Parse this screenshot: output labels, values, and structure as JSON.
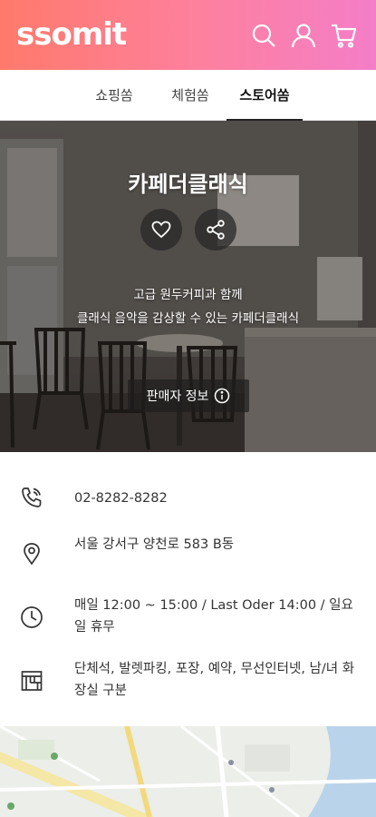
{
  "header": {
    "logo": "ssomit",
    "icons": [
      "search-icon",
      "user-icon",
      "cart-icon"
    ]
  },
  "tabs": [
    {
      "label": "쇼핑쏨"
    },
    {
      "label": "체험쏨"
    },
    {
      "label": "스토어쏨",
      "active": true
    }
  ],
  "store": {
    "name": "카페더클래식",
    "description_line1": "고급 원두커피과 함께",
    "description_line2": "클래식 음악을 감상할 수 있는 카페더클래식",
    "seller_info_label": "판매자 정보"
  },
  "info": {
    "phone": "02-8282-8282",
    "address": "서울 강서구 양천로 583 B동",
    "hours": "매일 12:00 ~ 15:00 / Last Oder 14:00 / 일요일 휴무",
    "facilities": "단체석, 발렛파킹, 포장, 예약, 무선인터넷, 남/녀 화장실 구분"
  },
  "colors": {
    "header_start": "#ff7a6b",
    "header_end": "#f47ec8"
  }
}
